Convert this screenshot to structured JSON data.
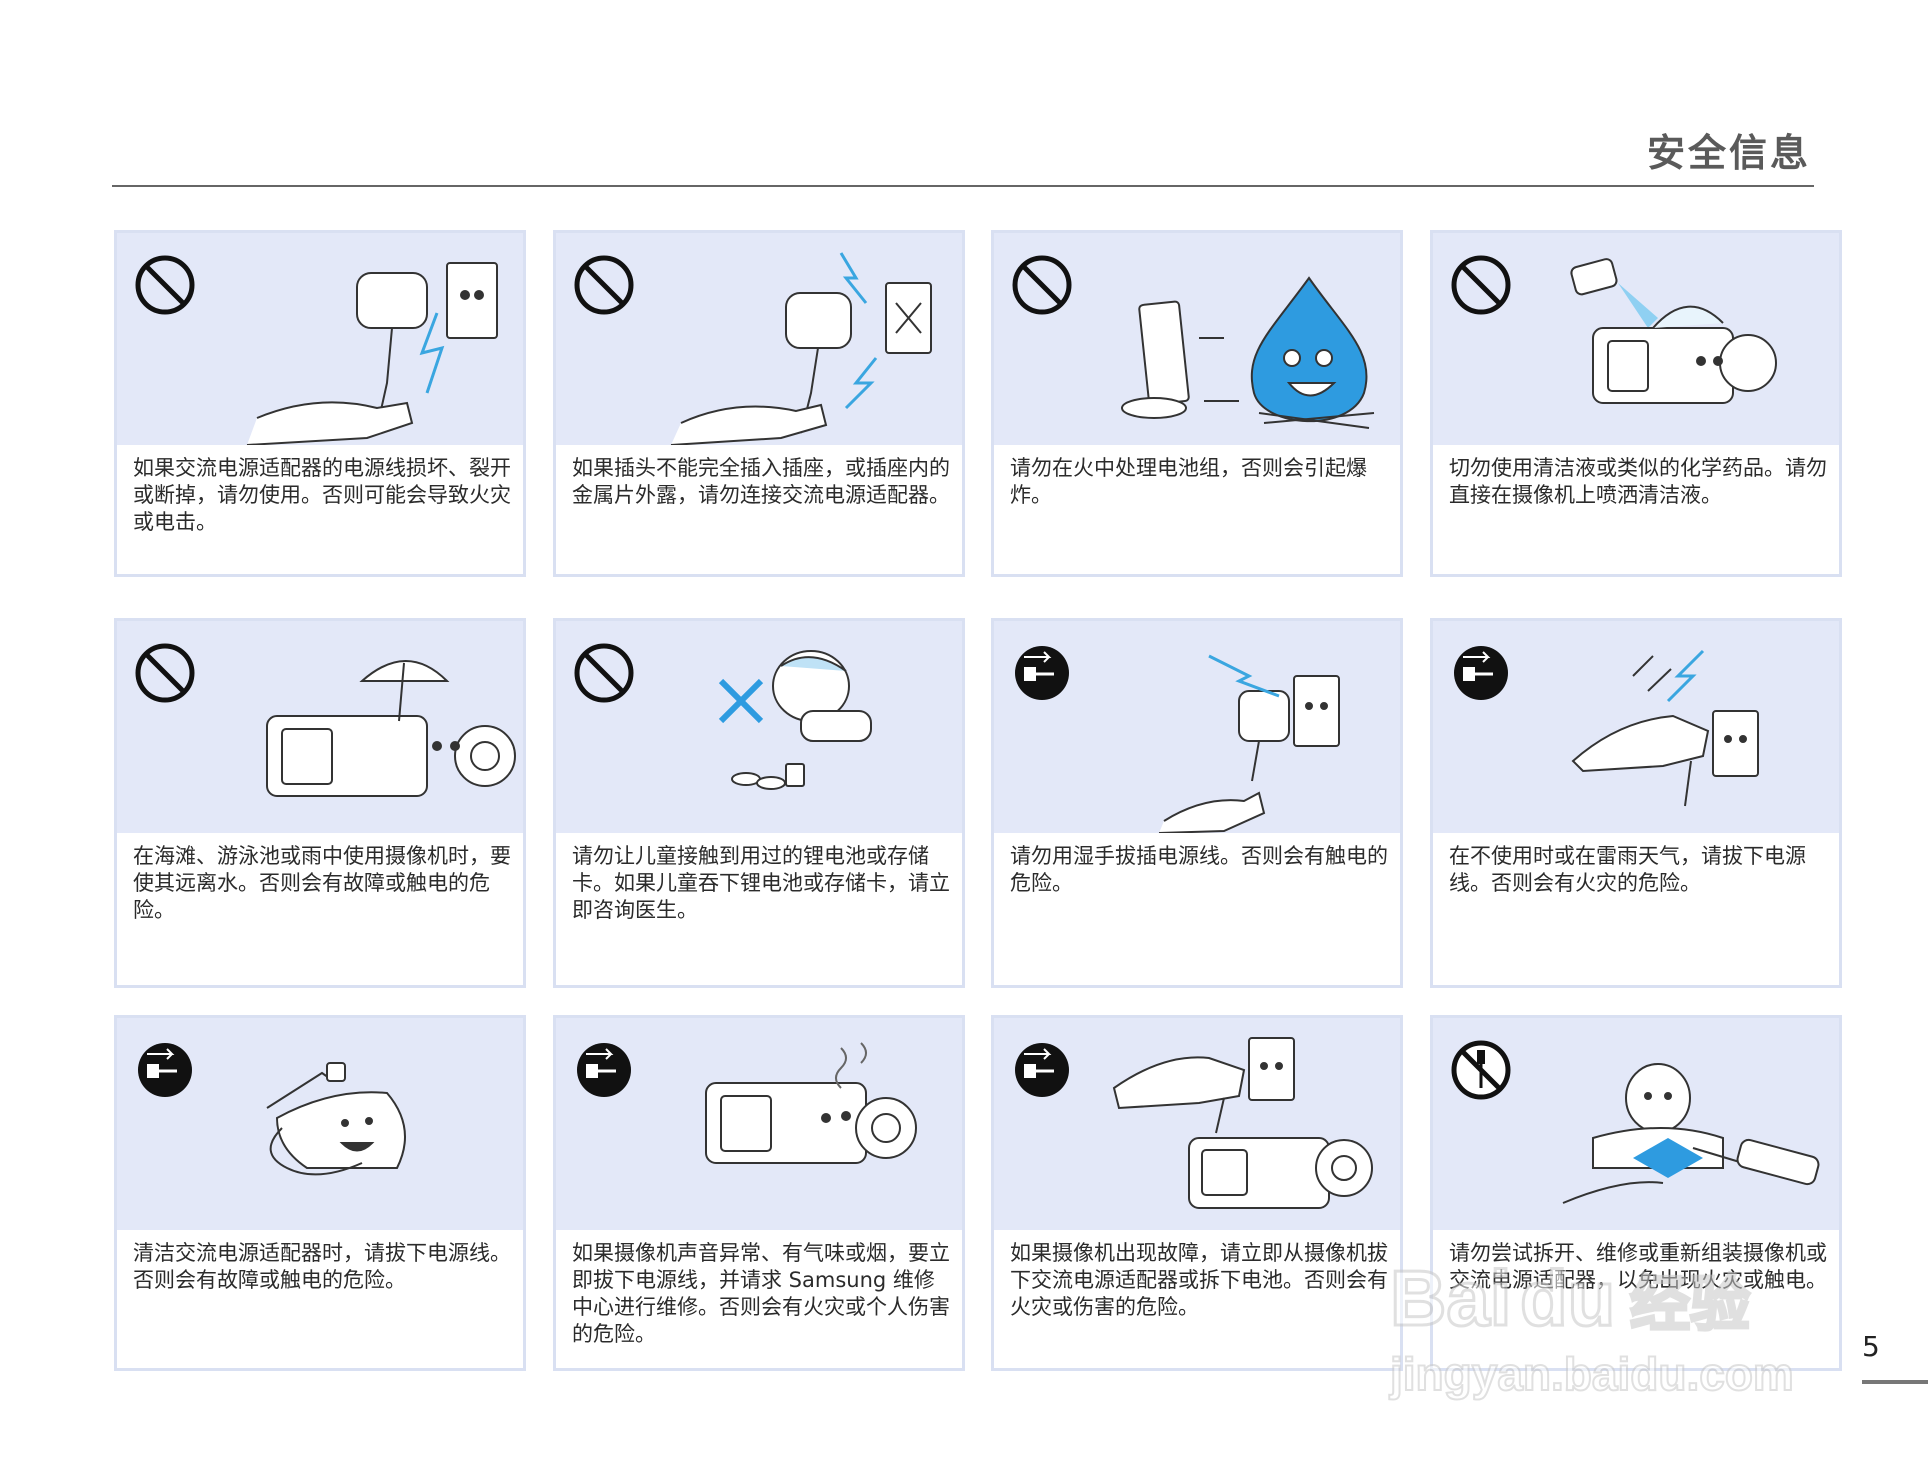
{
  "header": {
    "title": "安全信息"
  },
  "cards": [
    {
      "text": "如果交流电源适配器的电源线损坏、裂开或断掉，请勿使用。否则可能会导致火灾或电击。",
      "icon": "prohibition-icon"
    },
    {
      "text": "如果插头不能完全插入插座，或插座内的金属片外露，请勿连接交流电源适配器。",
      "icon": "prohibition-icon"
    },
    {
      "text": "请勿在火中处理电池组，否则会引起爆炸。",
      "icon": "prohibition-icon"
    },
    {
      "text": "切勿使用清洁液或类似的化学药品。请勿直接在摄像机上喷洒清洁液。",
      "icon": "prohibition-icon"
    },
    {
      "text": "在海滩、游泳池或雨中使用摄像机时，要使其远离水。否则会有故障或触电的危险。",
      "icon": "prohibition-icon"
    },
    {
      "text": "请勿让儿童接触到用过的锂电池或存储卡。如果儿童吞下锂电池或存储卡，请立即咨询医生。",
      "icon": "prohibition-icon"
    },
    {
      "text": "请勿用湿手拔插电源线。否则会有触电的危险。",
      "icon": "unplug-icon"
    },
    {
      "text": "在不使用时或在雷雨天气，请拔下电源线。否则会有火灾的危险。",
      "icon": "unplug-icon"
    },
    {
      "text": "清洁交流电源适配器时，请拔下电源线。否则会有故障或触电的危险。",
      "icon": "unplug-icon"
    },
    {
      "text": "如果摄像机声音异常、有气味或烟，要立即拔下电源线，并请求 Samsung 维修中心进行维修。否则会有火灾或个人伤害的危险。",
      "icon": "unplug-icon"
    },
    {
      "text": "如果摄像机出现故障，请立即从摄像机拔下交流电源适配器或拆下电池。否则会有火灾或伤害的危险。",
      "icon": "unplug-icon"
    },
    {
      "text": "请勿尝试拆开、维修或重新组装摄像机或交流电源适配器，以免出现火灾或触电。",
      "icon": "no-disassembly-icon"
    }
  ],
  "footer": {
    "page_number": "5"
  },
  "watermark": {
    "brand": "Baidu经验",
    "url": "jingyan.baidu.com"
  }
}
